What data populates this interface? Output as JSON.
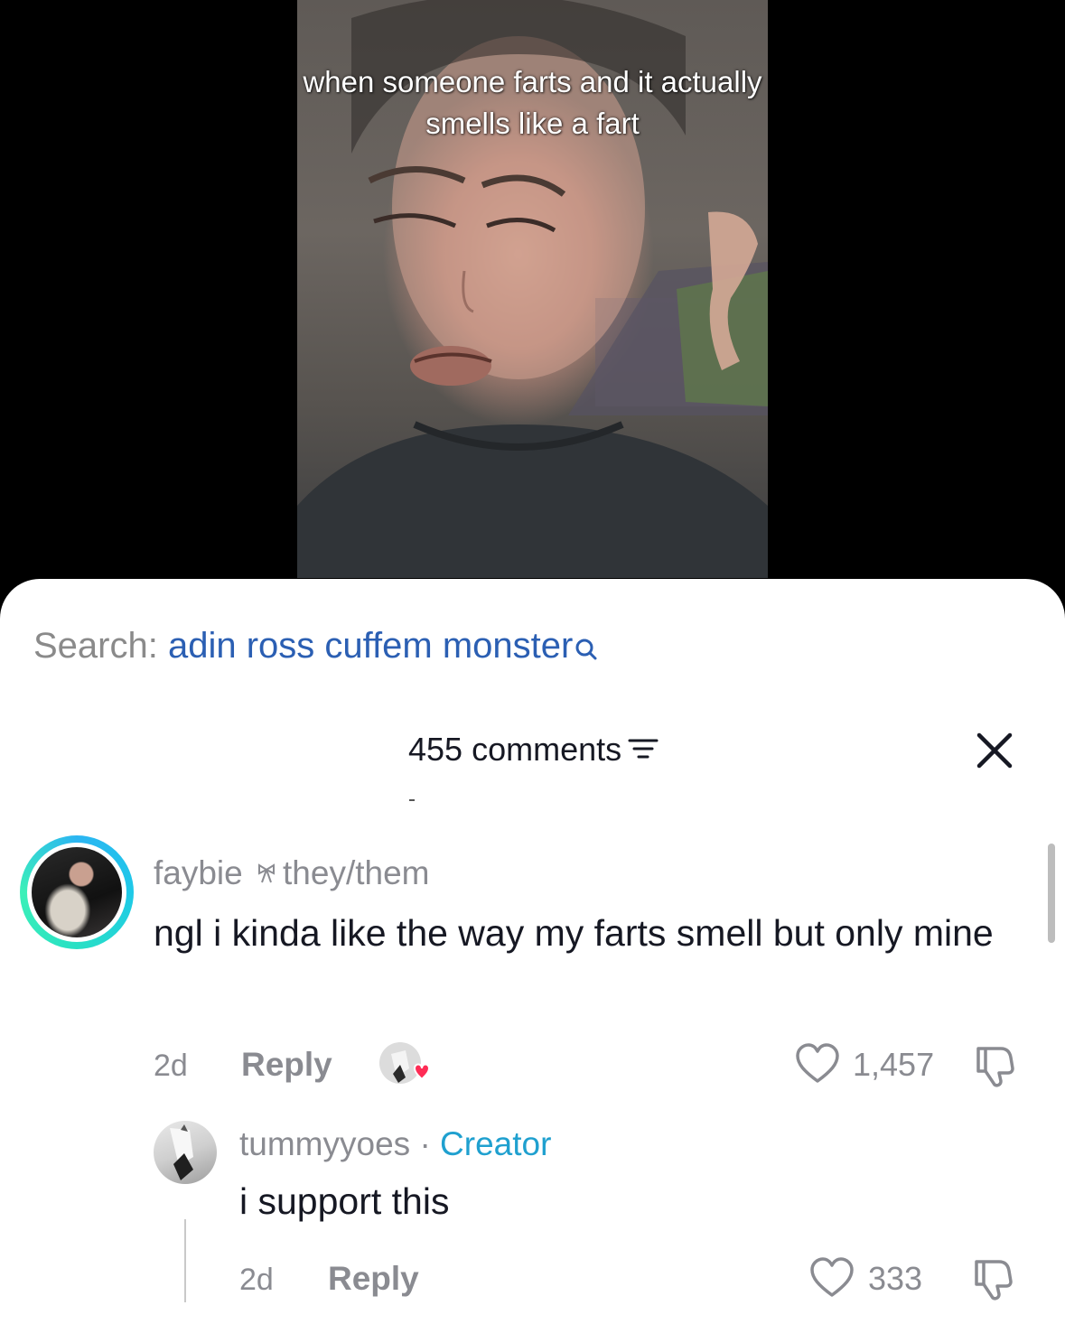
{
  "video": {
    "caption": "when someone farts and it actually smells like a fart"
  },
  "search": {
    "prefix": "Search:",
    "term": "adin ross cuffem monster"
  },
  "comments_header": {
    "count_label": "455 comments"
  },
  "comments": [
    {
      "username": "faybie",
      "pronoun_suffix": "they/them",
      "text": "ngl i kinda like the way my farts smell but only mine",
      "time": "2d",
      "reply_label": "Reply",
      "likes": "1,457",
      "replies": [
        {
          "username": "tummyyoes",
          "separator": "·",
          "badge": "Creator",
          "text": "i support this",
          "time": "2d",
          "reply_label": "Reply",
          "likes": "333"
        }
      ]
    }
  ],
  "colors": {
    "search_term": "#2b5fb3",
    "creator_badge": "#1fa0cf",
    "like_heart_badge": "#fe2c55",
    "ring_gradient": [
      "#2bb5f2",
      "#3cf0b8"
    ]
  },
  "icons": {
    "search": "search-icon",
    "filter": "filter-icon",
    "close": "close-icon",
    "like": "heart-icon",
    "dislike": "thumbs-down-icon",
    "bow": "bow-icon"
  }
}
